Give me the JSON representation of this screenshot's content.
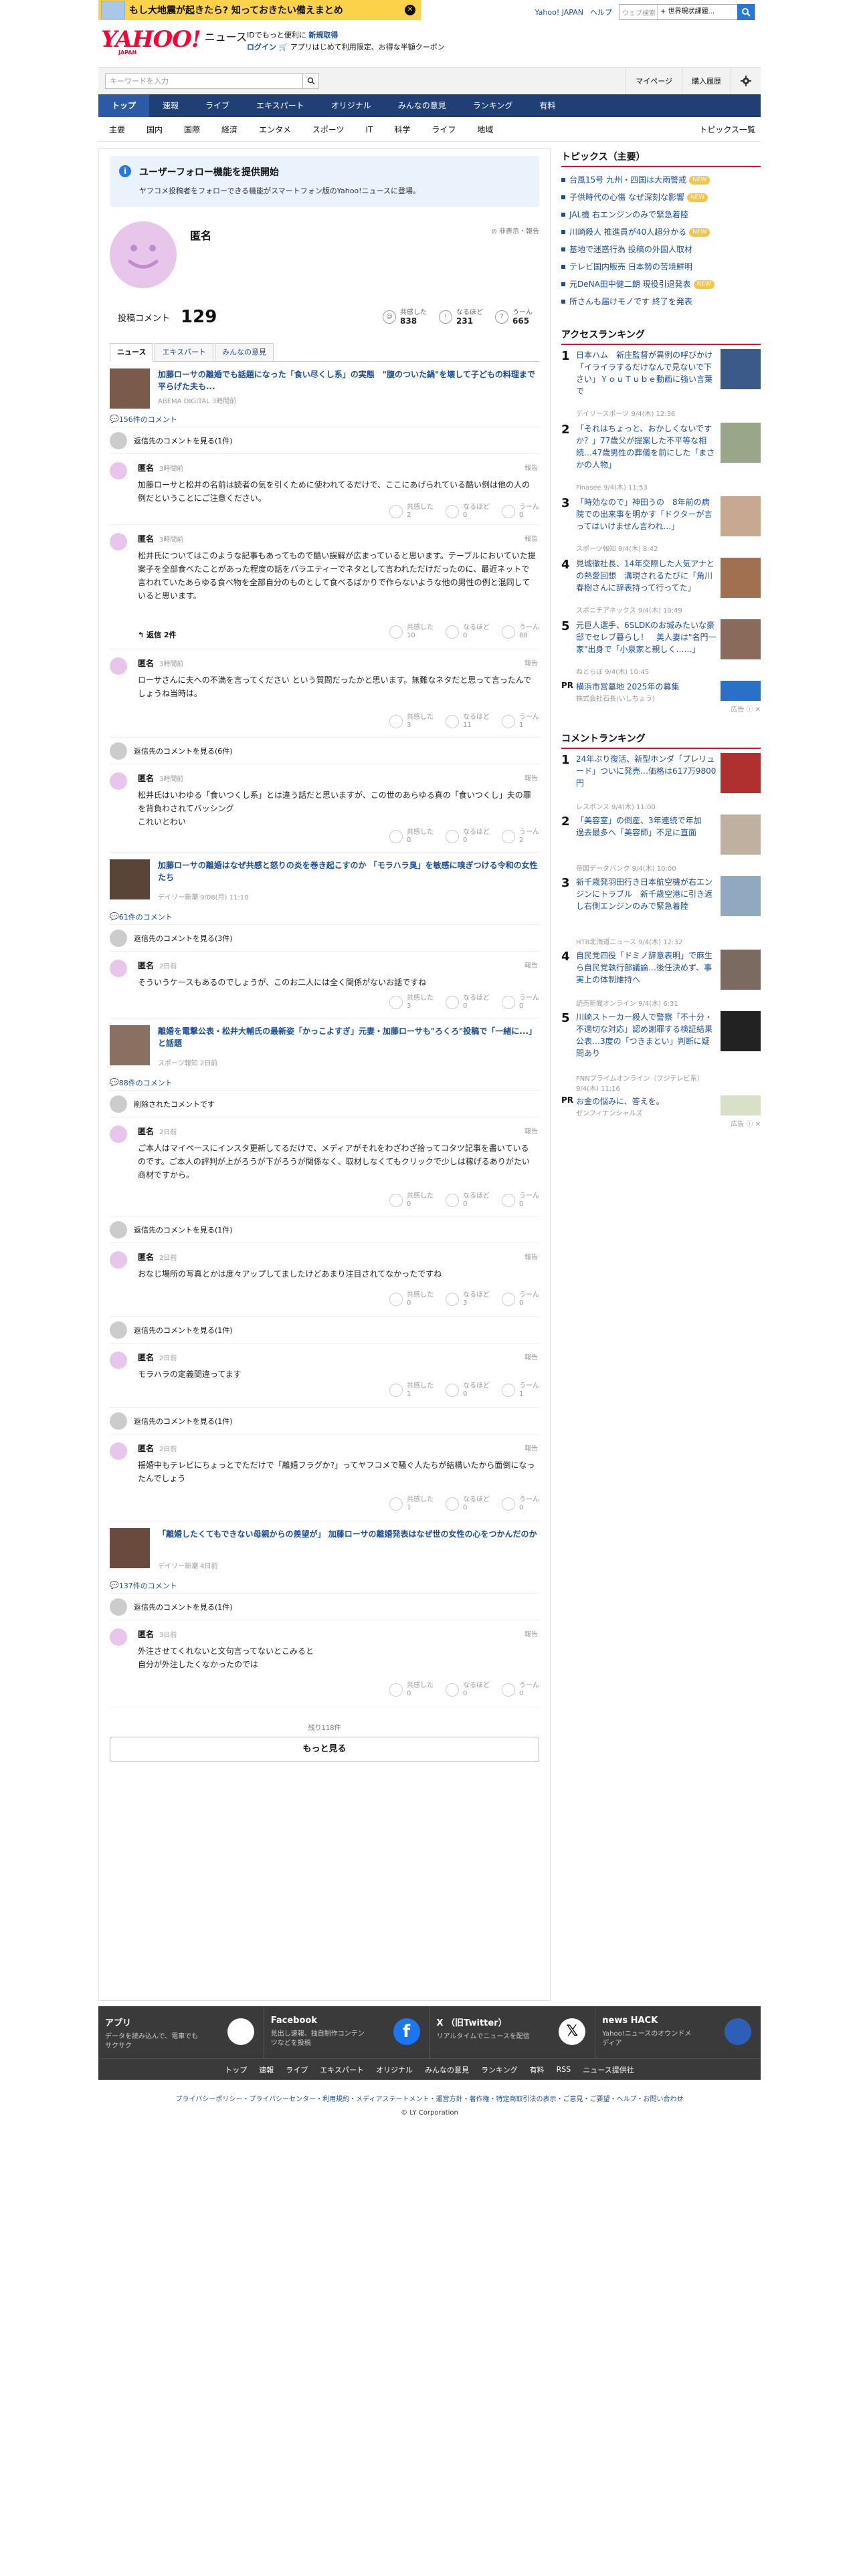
{
  "banner": {
    "text": "もし大地震が起きたら? 知っておきたい備えまとめ"
  },
  "toplinks": {
    "yahoo": "Yahoo! JAPAN",
    "help": "ヘルプ",
    "search_placeholder": "ウェブ検索",
    "search_select": "+ 世界現状課題..."
  },
  "logo": {
    "brand": "YAHOO!",
    "japan": "JAPAN",
    "news": "ニュース"
  },
  "promo": {
    "line1": "IDでもっと便利に",
    "line1b": "新規取得",
    "line2a": "ログイン",
    "line2b": "アプリはじめて利用限定、お得な半額クーポン"
  },
  "search": {
    "placeholder": "キーワードを入力",
    "mypage": "マイページ",
    "history": "購入履歴"
  },
  "gnav": [
    "トップ",
    "速報",
    "ライブ",
    "エキスパート",
    "オリジナル",
    "みんなの意見",
    "ランキング",
    "有料"
  ],
  "subnav": [
    "主要",
    "国内",
    "国際",
    "経済",
    "エンタメ",
    "スポーツ",
    "IT",
    "科学",
    "ライフ",
    "地域"
  ],
  "subnav_right": "トピックス一覧",
  "notice": {
    "title": "ユーザーフォロー機能を提供開始",
    "body": "ヤフコメ投稿者をフォローできる機能がスマートフォン版のYahoo!ニュースに登場。"
  },
  "profile": {
    "name": "匿名",
    "hide": "非表示・報告",
    "comment_label": "投稿コメント",
    "comment_count": "129",
    "reactions": [
      {
        "label": "共感した",
        "value": "838"
      },
      {
        "label": "なるほど",
        "value": "231"
      },
      {
        "label": "うーん",
        "value": "665"
      }
    ]
  },
  "tabs": [
    "ニュース",
    "エキスパート",
    "みんなの意見"
  ],
  "reaction_labels": [
    "共感した",
    "なるほど",
    "うーん"
  ],
  "report": "報告",
  "hidden_text": "返信先のコメントを見る(1件)",
  "hidden_text6": "返信先のコメントを見る(6件)",
  "hidden_text3": "返信先のコメントを見る(3件)",
  "deleted_text": "削除されたコメントです",
  "articles": [
    {
      "title": "加藤ローサの離婚でも話題になった「食い尽くし系」の実態　\"腹のついた鍋\"を壊して子どもの料理まで平らげた夫も...",
      "source": "ABEMA DIGITAL 3時間前",
      "count": "156件のコメント"
    },
    {
      "title": "加藤ローサの離婚はなぜ共感と怒りの炎を巻き起こすのか 「モラハラ臭」を敏感に嗅ぎつける令和の女性たち",
      "source": "デイリー新潮 9/08(月) 11:10",
      "count": "61件のコメント"
    },
    {
      "title": "離婚を電撃公表・松井大輔氏の最新姿「かっこよすぎ」元妻・加藤ローサも\"ろくろ\"投稿で「一緒に...」と話題",
      "source": "スポーツ報知 2日前",
      "count": "88件のコメント"
    },
    {
      "title": "「離婚したくてもできない母親からの羨望が」 加藤ローサの離婚発表はなぜ世の女性の心をつかんだのか",
      "source": "デイリー新潮 4日前",
      "count": "137件のコメント"
    }
  ],
  "comments": [
    {
      "name": "匿名",
      "time": "3時間前",
      "body": "加藤ローサと松井の名前は読者の気を引くために使われてるだけで、ここにあげられている酷い例は他の人の例だということにご注意ください。",
      "r": [
        "2",
        "0",
        "0"
      ]
    },
    {
      "name": "匿名",
      "time": "3時間前",
      "body": "松井氏についてはこのような記事もあってもので酷い誤解が広まっていると思います。テーブルにおいていた提案子を全部食べたことがあった程度の話をバラエティーでネタとして言われただけだったのに、最近ネットで言われていたあらゆる食べ物を全部自分のものとして食べるばかりで作らないような他の男性の例と混同していると思います。",
      "r": [
        "10",
        "0",
        "88"
      ],
      "reply": "返信 2件"
    },
    {
      "name": "匿名",
      "time": "3時間前",
      "body": "ローサさんに夫への不満を言ってください という質問だったかと思います。無難なネタだと思って言ったんでしょうね当時は。",
      "r": [
        "3",
        "11",
        "1"
      ]
    },
    {
      "name": "匿名",
      "time": "3時間前",
      "body": "松井氏はいわゆる「食いつくし系」とは違う話だと思いますが、この世のあらゆる真の「食いつくし」夫の罪を背負わされてバッシング\nこれいとわい",
      "r": [
        "0",
        "0",
        "2"
      ]
    },
    {
      "name": "匿名",
      "time": "2日前",
      "body": "そういうケースもあるのでしょうが、このお二人には全く関係がないお話ですね",
      "r": [
        "3",
        "0",
        "0"
      ]
    },
    {
      "name": "匿名",
      "time": "2日前",
      "body": "ご本人はマイペースにインスタ更新してるだけで、メディアがそれをわざわざ拾ってコタツ記事を書いているのです。ご本人の評判が上がろうが下がろうが関係なく、取材しなくてもクリックで少しは稼げるありがたい商材ですから。",
      "r": [
        "0",
        "0",
        "0"
      ]
    },
    {
      "name": "匿名",
      "time": "2日前",
      "body": "おなじ場所の写真とかは度々アップしてましたけどあまり注目されてなかったですね",
      "r": [
        "0",
        "3",
        "0"
      ]
    },
    {
      "name": "匿名",
      "time": "2日前",
      "body": "モラハラの定義間違ってます",
      "r": [
        "1",
        "0",
        "1"
      ]
    },
    {
      "name": "匿名",
      "time": "2日前",
      "body": "揺婚中もテレビにちょっとでただけで「離婚フラグか?」ってヤフコメで騒ぐ人たちが結構いたから面倒になったんでしょう",
      "r": [
        "1",
        "0",
        "0"
      ]
    },
    {
      "name": "匿名",
      "time": "3日前",
      "body": "外注させてくれないと文句言ってないとこみると\n自分が外注したくなかったのでは",
      "r": [
        "0",
        "0",
        "0"
      ]
    }
  ],
  "more": {
    "rest": "残り118件",
    "button": "もっと見る"
  },
  "side": {
    "topics_title": "トピックス（主要）",
    "topics": [
      {
        "t": "台風15号 九州・四国は大雨警戒",
        "new": "NEW"
      },
      {
        "t": "子供時代の心傷 なぜ深刻な影響",
        "new": "NEW"
      },
      {
        "t": "JAL機 右エンジンのみで緊急着陸",
        "new": ""
      },
      {
        "t": "川崎殺人 推進員が40人超分かる",
        "new": "NEW"
      },
      {
        "t": "基地で迷惑行為 投稿の外国人取材",
        "new": ""
      },
      {
        "t": "テレビ国内販売 日本勢の苦境鮮明",
        "new": ""
      },
      {
        "t": "元DeNA田中健二朗 現役引退発表",
        "new": "NEW"
      },
      {
        "t": "所さんも届けモノです 終了を発表",
        "new": ""
      }
    ],
    "access_title": "アクセスランキング",
    "access": [
      {
        "n": "1",
        "t": "日本ハム　新庄監督が異例の呼びかけ「イライラするだけなんで見ないで下さい」ＹｏｕＴｕｂｅ動画に強い言葉で",
        "s": "デイリースポーツ 9/4(木) 12:36"
      },
      {
        "n": "2",
        "t": "「それはちょっと、おかしくないですか？」77歳父が提案した不平等な相続…47歳男性の葬儀を前にした「まさかの人物」",
        "s": "Finasee 9/4(木) 11:53"
      },
      {
        "n": "3",
        "t": "「時効なので」神田うの　8年前の病院での出来事を明かす「ドクターが言ってはいけません言われ…」",
        "s": "スポーツ報知 9/4(木) 8:42"
      },
      {
        "n": "4",
        "t": "見城徹社長、14年交際した人気アナとの熱愛回想　溝現されるたびに「角川春樹さんに辞表持って行ってた」",
        "s": "スポニチアネックス 9/4(木) 10:49"
      },
      {
        "n": "5",
        "t": "元巨人選手、6SLDKのお城みたいな豪邸でセレブ暮らし！　美人妻は\"名門一家\"出身で「小泉家と親しく……」",
        "s": "ねとらぼ 9/4(木) 10:45"
      }
    ],
    "pr1": {
      "p": "PR",
      "t": "横浜市営墓地 2025年の募集",
      "s": "株式会社石長(いしちょう)",
      "ad": "広告"
    },
    "comment_title": "コメントランキング",
    "crank": [
      {
        "n": "1",
        "t": "24年ぶり復活、新型ホンダ「プレリュード」ついに発売…価格は617万9800円",
        "s": "レスポンス 9/4(木) 11:00"
      },
      {
        "n": "2",
        "t": "「美容室」の倒産、3年連続で年加　過去最多へ「美容師」不足に直面",
        "s": "帝国データバンク 9/4(木) 10:00"
      },
      {
        "n": "3",
        "t": "新千歳発羽田行き日本航空機が右エンジンにトラブル　新千歳空港に引き返し右側エンジンのみで緊急着陸",
        "s": "HTB北海道ニュース 9/4(木) 12:32"
      },
      {
        "n": "4",
        "t": "自民党四役「ドミノ辞意表明」で麻生ら自民党執行部議論…後任決めず、事実上の体制維持へ",
        "s": "読売新聞オンライン 9/4(木) 6:31"
      },
      {
        "n": "5",
        "t": "川崎ストーカー殺人で警察「不十分・不適切な対応」認め謝罪する検証結果公表…3度の「つきまとい」判断に疑問あり",
        "s": "FNNプライムオンライン（フジテレビ系） 9/4(木) 11:16"
      }
    ],
    "pr2": {
      "p": "PR",
      "t": "お金の悩みに、答えを。",
      "s": "ゼンフィナンシャルズ",
      "ad": "広告"
    }
  },
  "footer": {
    "cells": [
      {
        "t": "アプリ",
        "d": "データを読み込んで、電車でもサクサク"
      },
      {
        "t": "Facebook",
        "d": "見出し速報、独自制作コンテンツなどを投稿"
      },
      {
        "t": "X （旧Twitter）",
        "d": "リアルタイムでニュースを配信"
      },
      {
        "t": "news HACK",
        "d": "Yahoo!ニュースのオウンドメディア"
      }
    ],
    "links": [
      "トップ",
      "速報",
      "ライブ",
      "エキスパート",
      "オリジナル",
      "みんなの意見",
      "ランキング",
      "有料",
      "RSS",
      "ニュース提供社"
    ],
    "legal": "プライバシーポリシー・プライバシーセンター・利用規約・メディアステートメント・運営方針・著作権・特定商取引法の表示・ご意見・ご要望・ヘルプ・お問い合わせ",
    "copy": "© LY Corporation"
  }
}
